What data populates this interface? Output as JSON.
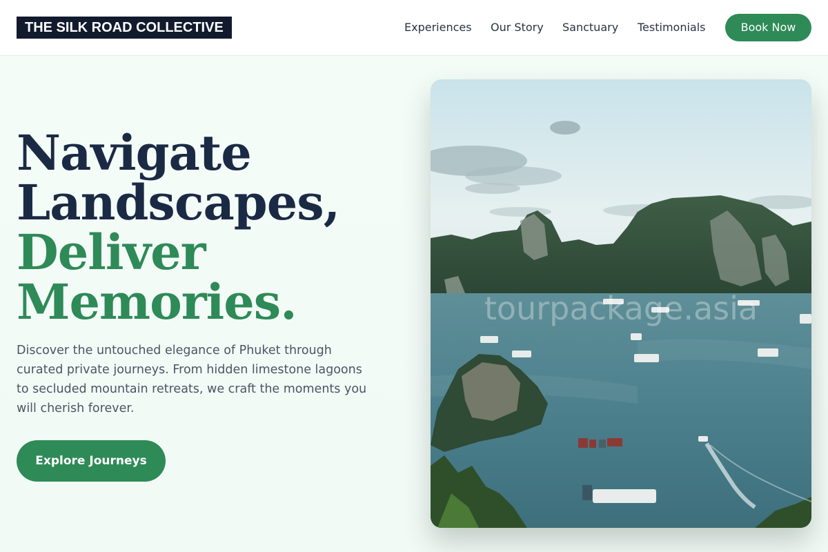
{
  "brand": {
    "logo_text": "THE SILK ROAD COLLECTIVE"
  },
  "nav": {
    "items": [
      {
        "label": "Experiences"
      },
      {
        "label": "Our Story"
      },
      {
        "label": "Sanctuary"
      },
      {
        "label": "Testimonials"
      }
    ],
    "cta_label": "Book Now"
  },
  "hero": {
    "headline_line1": "Navigate",
    "headline_line2": "Landscapes,",
    "headline_line3": "Deliver",
    "headline_line4": "Memories.",
    "description": "Discover the untouched elegance of Phuket through curated private journeys. From hidden limestone lagoons to secluded mountain retreats, we craft the moments you will cherish forever.",
    "cta_label": "Explore Journeys",
    "image_watermark": "tourpackage.asia"
  },
  "colors": {
    "accent": "#2e8a57",
    "heading_dark": "#1b2a44",
    "logo_bg": "#121a2e",
    "page_bg": "#f3fbf7"
  }
}
